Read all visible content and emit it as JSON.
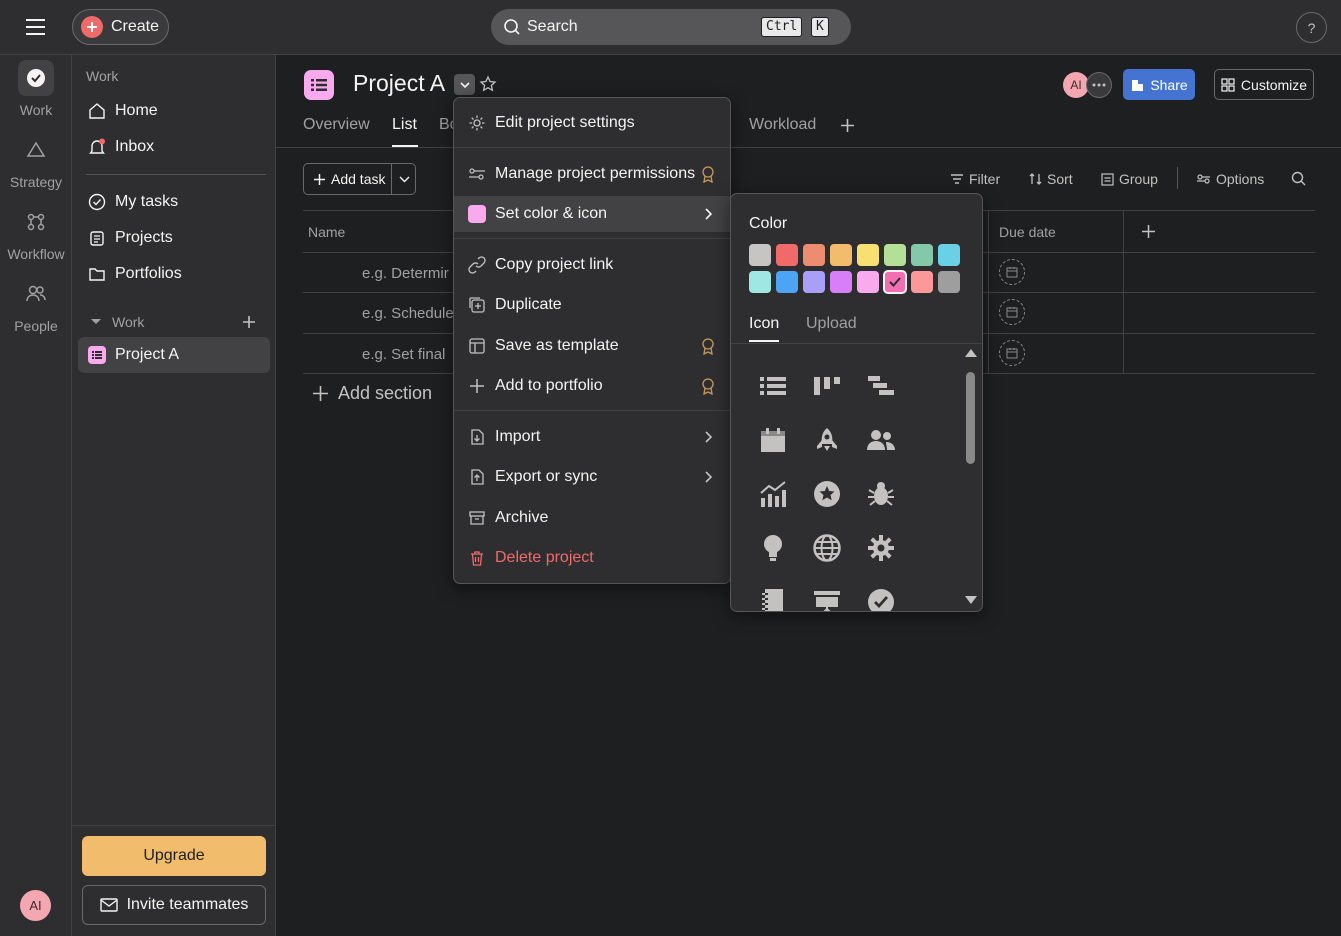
{
  "topbar": {
    "create_label": "Create",
    "search_label": "Search",
    "shortcut_keys": [
      "Ctrl",
      "K"
    ],
    "help_label": "?"
  },
  "rail": {
    "items": [
      {
        "label": "Work",
        "icon": "check-circle-icon"
      },
      {
        "label": "Strategy",
        "icon": "triangle-icon"
      },
      {
        "label": "Workflow",
        "icon": "workflow-icon"
      },
      {
        "label": "People",
        "icon": "people-icon"
      }
    ],
    "avatar_initials": "AI"
  },
  "sidebar": {
    "section_work": "Work",
    "items_top": [
      {
        "label": "Home",
        "icon": "home-icon"
      },
      {
        "label": "Inbox",
        "icon": "bell-icon"
      }
    ],
    "items_mid": [
      {
        "label": "My tasks",
        "icon": "check-circle-icon"
      },
      {
        "label": "Projects",
        "icon": "clipboard-icon"
      },
      {
        "label": "Portfolios",
        "icon": "folder-icon"
      }
    ],
    "group_label": "Work",
    "project_item": "Project A",
    "upgrade_label": "Upgrade",
    "invite_label": "Invite teammates"
  },
  "header": {
    "project_title": "Project A",
    "member_initials": "AI",
    "share_label": "Share",
    "customize_label": "Customize",
    "tabs": [
      "Overview",
      "List",
      "Bo",
      "Workload"
    ]
  },
  "toolbar": {
    "add_task_label": "Add task",
    "filter_label": "Filter",
    "sort_label": "Sort",
    "group_label": "Group",
    "options_label": "Options"
  },
  "table": {
    "col_name": "Name",
    "col_due": "Due date",
    "rows": [
      "e.g. Determir",
      "e.g. Schedule",
      "e.g. Set final"
    ],
    "add_section_label": "Add section"
  },
  "menu": {
    "items": [
      {
        "label": "Edit project settings",
        "icon": "gear-icon"
      },
      {
        "label": "Manage project permissions",
        "icon": "sliders-icon",
        "premium": true
      },
      {
        "label": "Set color & icon",
        "icon": "color-swatch-icon",
        "submenu": true
      },
      {
        "label": "Copy project link",
        "icon": "link-icon"
      },
      {
        "label": "Duplicate",
        "icon": "duplicate-icon"
      },
      {
        "label": "Save as template",
        "icon": "template-icon",
        "premium": true
      },
      {
        "label": "Add to portfolio",
        "icon": "plus-icon",
        "premium": true
      },
      {
        "label": "Import",
        "icon": "import-icon",
        "submenu": true
      },
      {
        "label": "Export or sync",
        "icon": "export-icon",
        "submenu": true
      },
      {
        "label": "Archive",
        "icon": "archive-icon"
      },
      {
        "label": "Delete project",
        "icon": "trash-icon",
        "danger": true
      }
    ]
  },
  "color_panel": {
    "heading": "Color",
    "colors_row1": [
      "#c7c4c4",
      "#f06a6a",
      "#ec8d71",
      "#f1bd6c",
      "#f8df72",
      "#b3df97",
      "#83c9a9",
      "#6ad0e7"
    ],
    "colors_row2": [
      "#9ee7e3",
      "#4ca4f5",
      "#aa9ff8",
      "#d97ef9",
      "#f9aaef",
      "#f26fb2",
      "#fc979a",
      "#9e9e9e"
    ],
    "selected_color": "#f26fb2",
    "tab_icon": "Icon",
    "tab_upload": "Upload",
    "icons": [
      "list-icon",
      "board-icon",
      "timeline-icon",
      "calendar-icon",
      "rocket-icon",
      "people-icon",
      "chart-icon",
      "star-icon",
      "bug-icon",
      "lightbulb-icon",
      "globe-icon",
      "gear-icon",
      "notebook-icon",
      "presentation-icon",
      "check-icon"
    ]
  }
}
